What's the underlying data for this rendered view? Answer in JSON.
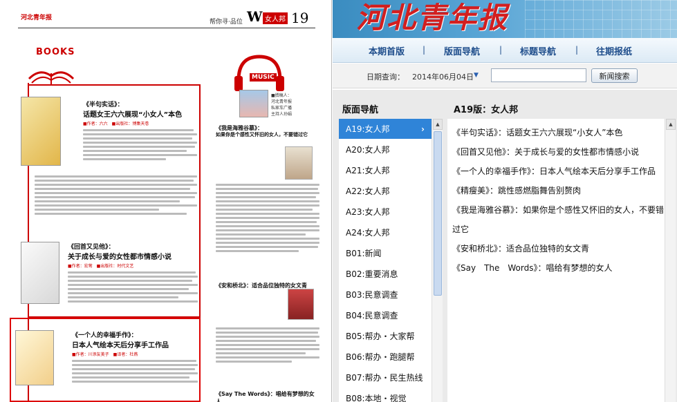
{
  "newspaper": {
    "logo": "河北青年报",
    "slogan": "帮你寻·品位",
    "section_letter": "W",
    "section_badge": "女人邦",
    "page_number": "19",
    "books_label": "BOOKS",
    "music_label": "MUSIC",
    "host_info": [
      "■撰稿人：",
      "河北青年报",
      "私家车广播",
      "主持人孙娟"
    ],
    "articles": [
      {
        "title1": "《半句实话》：",
        "title2": "话题女王六六展现“小女人”本色",
        "meta": "■作者：六六　■出版社：博集天卷"
      },
      {
        "title1": "《回首又见他》：",
        "title2": "关于成长与爱的女性都市情感小说",
        "meta": "■作者：宏莺　■出版社：时代文艺"
      },
      {
        "title1": "《一个人的幸福手作》：",
        "title2": "日本人气绘本天后分享手工作品",
        "meta": "■作者：川添友美子　■译者：杜燕"
      }
    ],
    "music_titles": [
      "《我是海雅谷慕》：",
      "如果你是个感性又怀旧的女人，不要错过它",
      "《安和桥北》：适合品位独特的女文青",
      "《Say The Words》：唱给有梦想的女人"
    ]
  },
  "site": {
    "banner_title": "河北青年报",
    "nav": [
      "本期首版",
      "版面导航",
      "标题导航",
      "往期报纸"
    ],
    "nav_sep": "|",
    "query": {
      "label": "日期查询：",
      "date": "2014年06月04日",
      "arrow": "▼",
      "search_value": "",
      "search_button": "新闻搜索"
    },
    "section_nav_heading": "版面导航",
    "current_page_heading": "A19版：女人邦",
    "pages": [
      {
        "label": "A19:女人邦",
        "active": true
      },
      {
        "label": "A20:女人邦"
      },
      {
        "label": "A21:女人邦"
      },
      {
        "label": "A22:女人邦"
      },
      {
        "label": "A23:女人邦"
      },
      {
        "label": "A24:女人邦"
      },
      {
        "label": "B01:新闻"
      },
      {
        "label": "B02:重要消息"
      },
      {
        "label": "B03:民意调查"
      },
      {
        "label": "B04:民意调查"
      },
      {
        "label": "B05:帮办・大家帮"
      },
      {
        "label": "B06:帮办・跑腿帮"
      },
      {
        "label": "B07:帮办・民生热线"
      },
      {
        "label": "B08:本地・视觉"
      }
    ],
    "active_chevron": "›",
    "articles": [
      "《半句实话》：话题女王六六展现“小女人”本色",
      "《回首又见他》：关于成长与爱的女性都市情感小说",
      "《一个人的幸福手作》：日本人气绘本天后分享手工作品",
      "《精瘦美》：跳性感燃脂舞告别赘肉",
      "《我是海雅谷慕》：如果你是个感性又怀旧的女人，不要错过它",
      "《安和桥北》：适合品位独特的女文青",
      "《Say　The　Words》：唱给有梦想的女人"
    ],
    "colors": {
      "active_item": "#2f84d8",
      "nav_text": "#1f4e8c",
      "banner_title": "#d21f1f"
    }
  }
}
